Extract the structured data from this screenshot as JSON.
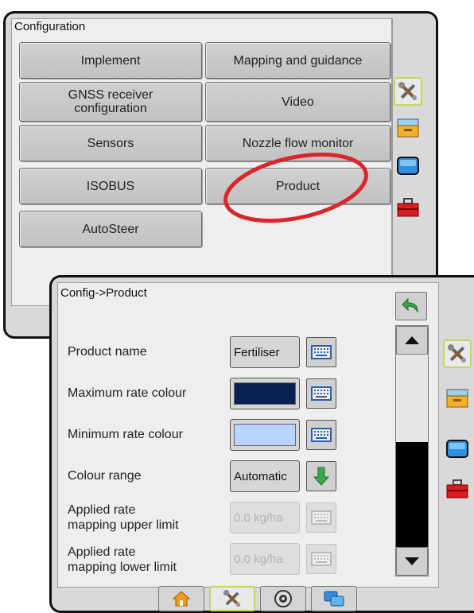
{
  "back_screen": {
    "title": "Configuration",
    "buttons": [
      {
        "label": "Implement"
      },
      {
        "label": "Mapping and guidance"
      },
      {
        "label": "GNSS receiver configuration"
      },
      {
        "label": "Video"
      },
      {
        "label": "Sensors"
      },
      {
        "label": "Nozzle flow monitor"
      },
      {
        "label": "ISOBUS"
      },
      {
        "label": "Product"
      },
      {
        "label": "AutoSteer"
      }
    ],
    "highlighted": "Product",
    "highlight_color": "#d9262a"
  },
  "side_tabs": [
    {
      "name": "tools",
      "icon": "tools-icon",
      "active": true
    },
    {
      "name": "data",
      "icon": "data-drawer-icon",
      "active": false
    },
    {
      "name": "display",
      "icon": "display-icon",
      "active": false
    },
    {
      "name": "toolbox",
      "icon": "toolbox-icon",
      "active": false
    }
  ],
  "front_screen": {
    "title": "Config->Product",
    "back_icon": "back-arrow-icon",
    "rows": [
      {
        "label": "Product name",
        "value": "Fertiliser",
        "type": "text"
      },
      {
        "label": "Maximum rate colour",
        "color": "#0b2156",
        "type": "color"
      },
      {
        "label": "Minimum rate colour",
        "color": "#b9d4ff",
        "type": "color"
      },
      {
        "label": "Colour range",
        "value": "Automatic",
        "type": "dropdown"
      },
      {
        "label": "Applied rate\nmapping upper limit",
        "value": "0.0 kg/ha",
        "type": "disabled"
      },
      {
        "label": "Applied rate\nmapping lower limit",
        "value": "0.0 kg/ha",
        "type": "disabled"
      }
    ],
    "bottom_tabs": [
      {
        "name": "home",
        "icon": "home-icon"
      },
      {
        "name": "tools",
        "icon": "tools-icon",
        "active": true
      },
      {
        "name": "gauge",
        "icon": "gauge-icon"
      },
      {
        "name": "views",
        "icon": "views-icon"
      }
    ]
  }
}
